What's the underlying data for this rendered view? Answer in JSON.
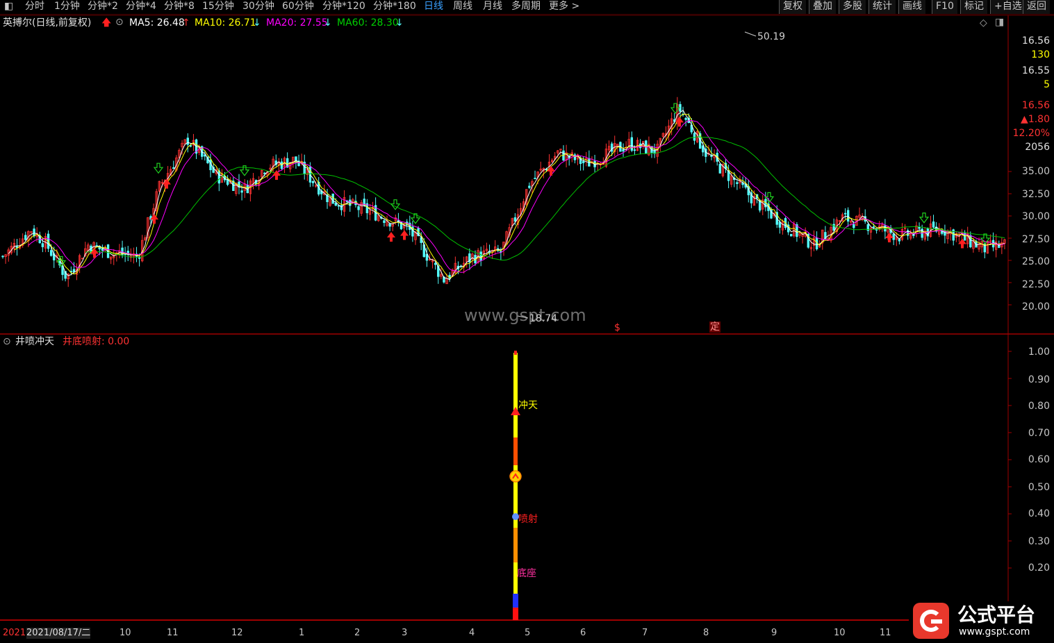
{
  "toolbar": {
    "items": [
      "分时",
      "1分钟",
      "分钟*2",
      "分钟*4",
      "分钟*8",
      "15分钟",
      "30分钟",
      "60分钟",
      "分钟*120",
      "分钟*180",
      "日线",
      "周线",
      "月线",
      "多周期",
      "更多 >"
    ],
    "active": "日线",
    "right_items": [
      "复权",
      "叠加",
      "多股",
      "统计",
      "画线",
      "F10",
      "标记",
      "+自选",
      "返回"
    ]
  },
  "main_chart": {
    "title": "英搏尔(日线,前复权)",
    "ma5": "MA5: 26.48",
    "ma10": "MA10: 26.71",
    "ma20": "MA20: 27.55",
    "ma60": "MA60: 28.30",
    "high_label": "50.19",
    "low_label": "18.74",
    "marker_s": "$",
    "marker_ding": "定",
    "watermark": "www.gspt.com",
    "info_panel": [
      "16.56",
      "130",
      "16.55",
      "5",
      "16.56",
      "▲1.80",
      "12.20%",
      "2056"
    ],
    "y_ticks": [
      "35.00",
      "32.50",
      "30.00",
      "27.50",
      "25.00",
      "22.50",
      "20.00"
    ]
  },
  "indicator": {
    "name": "井喷冲天",
    "value_label": "井底喷射: 0.00",
    "label_chongtian": "冲天",
    "label_penshe": "喷射",
    "label_dizuo": "底座",
    "y_ticks": [
      "1.00",
      "0.90",
      "0.80",
      "0.70",
      "0.60",
      "0.50",
      "0.40",
      "0.30",
      "0.20"
    ]
  },
  "date_axis": [
    "2021",
    "2021/08/17/二",
    "10",
    "11",
    "12",
    "1",
    "2",
    "3",
    "4",
    "5",
    "6",
    "7",
    "8",
    "9",
    "10",
    "11"
  ],
  "logo": {
    "text": "公式平台",
    "url": "www.gspt.com"
  },
  "colors": {
    "up": "#ff3232",
    "down": "#54ffff",
    "ma5": "#ffffff",
    "ma10": "#ffff00",
    "ma20": "#ff00ff",
    "ma60": "#00c000",
    "grid_red": "#a00000"
  }
}
